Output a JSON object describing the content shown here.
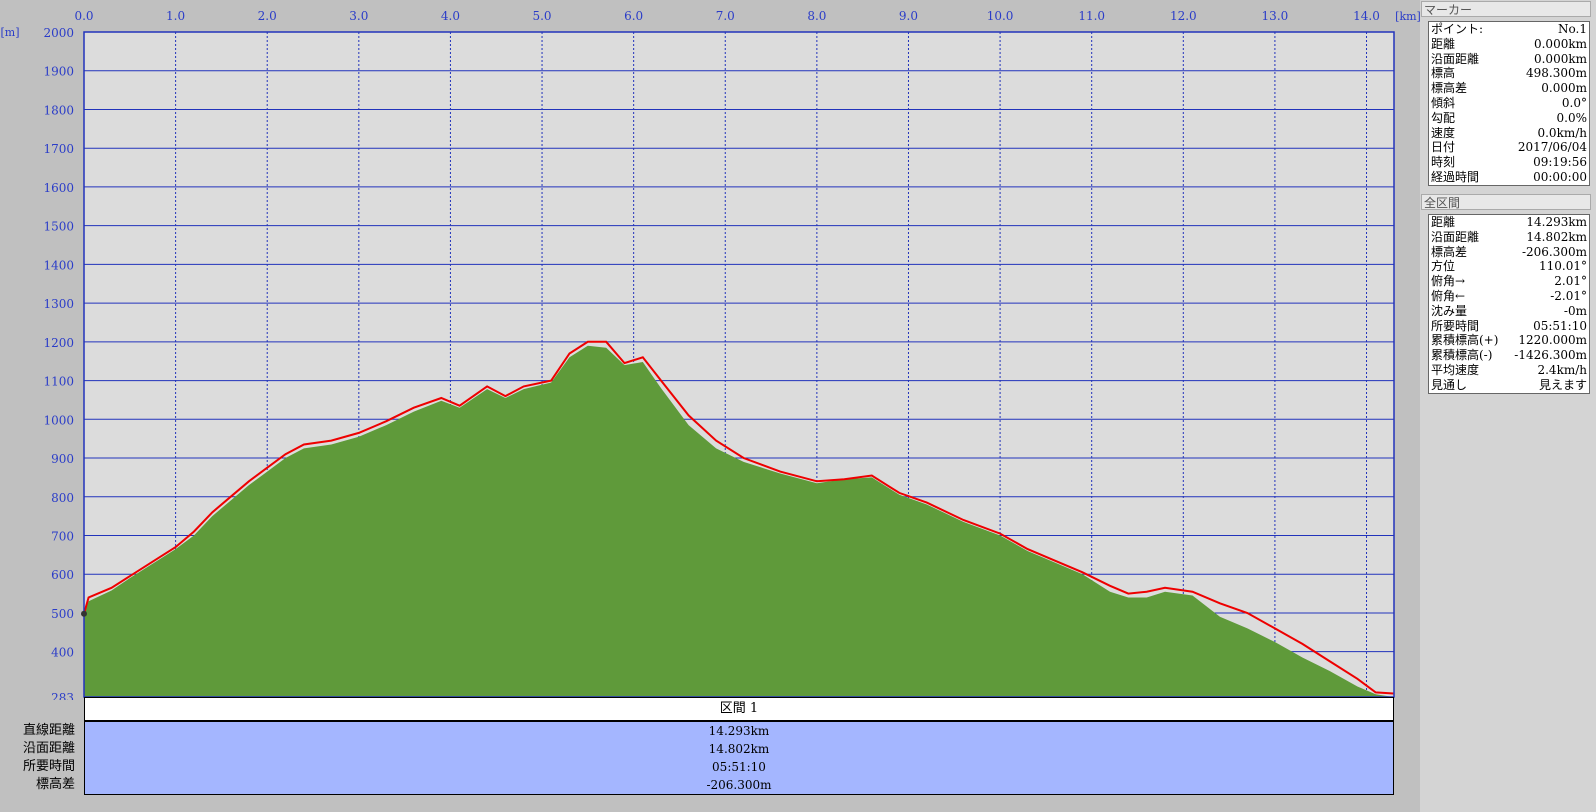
{
  "chart": {
    "x_unit": "[km]",
    "y_unit": "[m]",
    "x_ticks": [
      "0.0",
      "1.0",
      "2.0",
      "3.0",
      "4.0",
      "5.0",
      "6.0",
      "7.0",
      "8.0",
      "9.0",
      "10.0",
      "11.0",
      "12.0",
      "13.0",
      "14.0"
    ],
    "y_ticks": [
      "2000",
      "1900",
      "1800",
      "1700",
      "1600",
      "1500",
      "1400",
      "1300",
      "1200",
      "1100",
      "1000",
      "900",
      "800",
      "700",
      "600",
      "500",
      "400",
      "283"
    ],
    "colors": {
      "plot_bg": "#dcdcdc",
      "grid": "#2233bb",
      "terrain": "#5f9a3a",
      "track": "#ee0000",
      "axis_text": "#2a3cc8"
    }
  },
  "chart_data": {
    "type": "area",
    "xlabel": "[km]",
    "ylabel": "[m]",
    "xlim": [
      0,
      14.3
    ],
    "ylim": [
      283,
      2000
    ],
    "grid": true,
    "series": [
      {
        "values": [
          [
            0,
            498
          ],
          [
            0.05,
            540
          ],
          [
            0.3,
            565
          ],
          [
            0.5,
            595
          ],
          [
            0.8,
            640
          ],
          [
            1.0,
            670
          ],
          [
            1.2,
            710
          ],
          [
            1.4,
            760
          ],
          [
            1.6,
            800
          ],
          [
            1.8,
            840
          ],
          [
            2.0,
            875
          ],
          [
            2.2,
            910
          ],
          [
            2.4,
            935
          ],
          [
            2.7,
            945
          ],
          [
            3.0,
            965
          ],
          [
            3.3,
            995
          ],
          [
            3.6,
            1030
          ],
          [
            3.9,
            1055
          ],
          [
            4.1,
            1035
          ],
          [
            4.4,
            1085
          ],
          [
            4.6,
            1060
          ],
          [
            4.8,
            1085
          ],
          [
            5.1,
            1100
          ],
          [
            5.3,
            1170
          ],
          [
            5.5,
            1200
          ],
          [
            5.7,
            1200
          ],
          [
            5.9,
            1145
          ],
          [
            6.1,
            1160
          ],
          [
            6.3,
            1100
          ],
          [
            6.6,
            1010
          ],
          [
            6.9,
            945
          ],
          [
            7.2,
            900
          ],
          [
            7.6,
            865
          ],
          [
            8.0,
            840
          ],
          [
            8.3,
            845
          ],
          [
            8.6,
            855
          ],
          [
            8.9,
            810
          ],
          [
            9.2,
            785
          ],
          [
            9.6,
            740
          ],
          [
            10.0,
            705
          ],
          [
            10.3,
            665
          ],
          [
            10.6,
            635
          ],
          [
            10.9,
            605
          ],
          [
            11.2,
            570
          ],
          [
            11.4,
            550
          ],
          [
            11.6,
            555
          ],
          [
            11.8,
            565
          ],
          [
            12.1,
            555
          ],
          [
            12.4,
            525
          ],
          [
            12.7,
            500
          ],
          [
            13.0,
            460
          ],
          [
            13.3,
            420
          ],
          [
            13.6,
            375
          ],
          [
            13.9,
            330
          ],
          [
            14.1,
            295
          ],
          [
            14.293,
            292
          ]
        ]
      },
      {
        "values": [
          [
            0,
            498
          ],
          [
            0.05,
            530
          ],
          [
            0.3,
            558
          ],
          [
            0.5,
            590
          ],
          [
            0.8,
            635
          ],
          [
            1.0,
            665
          ],
          [
            1.2,
            700
          ],
          [
            1.4,
            750
          ],
          [
            1.6,
            790
          ],
          [
            1.8,
            830
          ],
          [
            2.0,
            865
          ],
          [
            2.2,
            900
          ],
          [
            2.4,
            925
          ],
          [
            2.7,
            935
          ],
          [
            3.0,
            955
          ],
          [
            3.3,
            985
          ],
          [
            3.6,
            1020
          ],
          [
            3.9,
            1048
          ],
          [
            4.1,
            1030
          ],
          [
            4.4,
            1078
          ],
          [
            4.6,
            1055
          ],
          [
            4.8,
            1078
          ],
          [
            5.1,
            1095
          ],
          [
            5.3,
            1160
          ],
          [
            5.5,
            1190
          ],
          [
            5.7,
            1185
          ],
          [
            5.9,
            1140
          ],
          [
            6.1,
            1148
          ],
          [
            6.3,
            1080
          ],
          [
            6.6,
            985
          ],
          [
            6.9,
            925
          ],
          [
            7.2,
            890
          ],
          [
            7.6,
            860
          ],
          [
            8.0,
            835
          ],
          [
            8.3,
            845
          ],
          [
            8.6,
            850
          ],
          [
            8.9,
            805
          ],
          [
            9.2,
            780
          ],
          [
            9.6,
            735
          ],
          [
            10.0,
            700
          ],
          [
            10.3,
            660
          ],
          [
            10.6,
            630
          ],
          [
            10.9,
            600
          ],
          [
            11.2,
            555
          ],
          [
            11.4,
            540
          ],
          [
            11.6,
            540
          ],
          [
            11.8,
            555
          ],
          [
            12.1,
            545
          ],
          [
            12.4,
            490
          ],
          [
            12.7,
            460
          ],
          [
            13.0,
            425
          ],
          [
            13.3,
            385
          ],
          [
            13.6,
            350
          ],
          [
            13.9,
            310
          ],
          [
            14.1,
            290
          ],
          [
            14.293,
            283
          ]
        ]
      }
    ]
  },
  "marker": {
    "title": "マーカー",
    "rows": [
      {
        "label": "ポイント:",
        "value": "No.1"
      },
      {
        "label": "距離",
        "value": "0.000km"
      },
      {
        "label": "沿面距離",
        "value": "0.000km"
      },
      {
        "label": "標高",
        "value": "498.300m"
      },
      {
        "label": "標高差",
        "value": "0.000m"
      },
      {
        "label": "傾斜",
        "value": "0.0°"
      },
      {
        "label": "勾配",
        "value": "0.0%"
      },
      {
        "label": "速度",
        "value": "0.0km/h"
      },
      {
        "label": "日付",
        "value": "2017/06/04"
      },
      {
        "label": "時刻",
        "value": "09:19:56"
      },
      {
        "label": "経過時間",
        "value": "00:00:00"
      }
    ]
  },
  "whole": {
    "title": "全区間",
    "rows": [
      {
        "label": "距離",
        "value": "14.293km"
      },
      {
        "label": "沿面距離",
        "value": "14.802km"
      },
      {
        "label": "標高差",
        "value": "-206.300m"
      },
      {
        "label": "方位",
        "value": "110.01°"
      },
      {
        "label": "俯角→",
        "value": "2.01°"
      },
      {
        "label": "俯角←",
        "value": "-2.01°"
      },
      {
        "label": "沈み量",
        "value": "-0m"
      },
      {
        "label": "所要時間",
        "value": "05:51:10"
      },
      {
        "label": "累積標高(+)",
        "value": "1220.000m"
      },
      {
        "label": "累積標高(-)",
        "value": "-1426.300m"
      },
      {
        "label": "平均速度",
        "value": "2.4km/h"
      },
      {
        "label": "見通し",
        "value": "見えます"
      }
    ]
  },
  "section": {
    "header": "区間 1",
    "rows": [
      {
        "label": "直線距離",
        "value": "14.293km"
      },
      {
        "label": "沿面距離",
        "value": "14.802km"
      },
      {
        "label": "所要時間",
        "value": "05:51:10"
      },
      {
        "label": "標高差",
        "value": "-206.300m"
      }
    ]
  }
}
